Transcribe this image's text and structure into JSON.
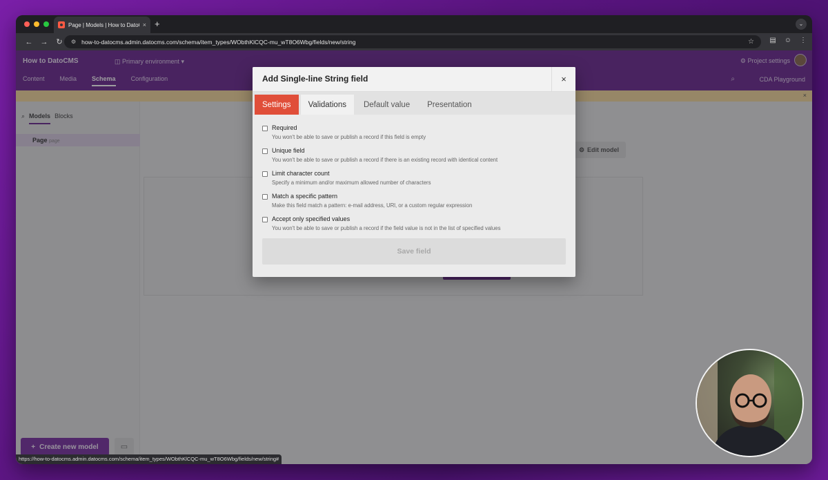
{
  "browser": {
    "tab_title": "Page | Models | How to DatoCMS",
    "tab_close": "×",
    "new_tab": "+",
    "url": "how-to-datocms.admin.datocms.com/schema/item_types/WObthKlCQC-mu_wT8O6Wbg/fields/new/string",
    "status_url": "https://how-to-datocms.admin.datocms.com/schema/item_types/WObthKlCQC-mu_wT8O6Wbg/fields/new/string#"
  },
  "app": {
    "brand": "How to DatoCMS",
    "environment": "Primary environment",
    "project_settings": "Project settings",
    "nav": [
      {
        "label": "Content"
      },
      {
        "label": "Media"
      },
      {
        "label": "Schema"
      },
      {
        "label": "Configuration"
      }
    ],
    "cda_playground": "CDA Playground",
    "sidebar": {
      "tab_models": "Models",
      "tab_blocks": "Blocks",
      "item": "Page",
      "item_sub": "page",
      "create_button": "Create new model"
    },
    "edit_model": "Edit model"
  },
  "modal": {
    "title": "Add Single-line String field",
    "close": "×",
    "tabs": [
      {
        "label": "Settings"
      },
      {
        "label": "Validations"
      },
      {
        "label": "Default value"
      },
      {
        "label": "Presentation"
      }
    ],
    "options": [
      {
        "label": "Required",
        "hint": "You won't be able to save or publish a record if this field is empty"
      },
      {
        "label": "Unique field",
        "hint": "You won't be able to save or publish a record if there is an existing record with identical content"
      },
      {
        "label": "Limit character count",
        "hint": "Specify a minimum and/or maximum allowed number of characters"
      },
      {
        "label": "Match a specific pattern",
        "hint": "Make this field match a pattern: e-mail address, URl, or a custom regular expression"
      },
      {
        "label": "Accept only specified values",
        "hint": "You won't be able to save or publish a record if the field value is not in the list of specified values"
      }
    ],
    "save_button": "Save field"
  }
}
